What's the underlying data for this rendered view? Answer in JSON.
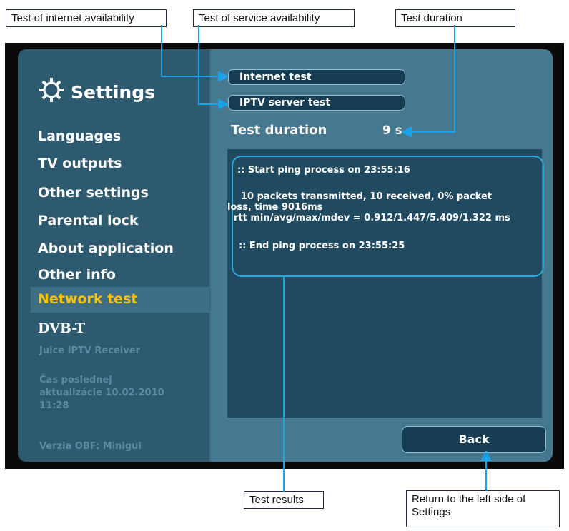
{
  "callouts": {
    "internet": "Test of internet availability",
    "service": "Test of service availability",
    "duration": "Test duration",
    "results": "Test results",
    "return": "Return to the left side of Settings"
  },
  "settings": {
    "title": "Settings",
    "icon": "gear-icon"
  },
  "menu": {
    "items": [
      "Languages",
      "TV outputs",
      "Other settings",
      "Parental lock",
      "About application",
      "Other info",
      "Network test",
      "DVB-T"
    ],
    "selected": "Network test"
  },
  "info": {
    "receiver": "Juice IPTV Receiver",
    "update_label": "Čas poslednej",
    "update_line2": "aktualizácie 10.02.2010",
    "update_line3": "11:28",
    "version": "Verzia OBF: Minigui"
  },
  "tests": {
    "internet_button": "Internet test",
    "iptv_button": "IPTV server test",
    "duration_label": "Test duration",
    "duration_value": "9 s"
  },
  "results": {
    "line1": ":: Start ping process on 23:55:16",
    "line2": "10 packets transmitted, 10 received, 0% packet",
    "line3": "loss, time 9016ms",
    "line4": "rtt min/avg/max/mdev = 0.912/1.447/5.409/1.322 ms",
    "line5": ":: End ping process on 23:55:25"
  },
  "back_label": "Back",
  "colors": {
    "screen_bg": "#3b6b83",
    "selected_text": "#ffc000",
    "highlight_line": "#2aa8e0"
  }
}
